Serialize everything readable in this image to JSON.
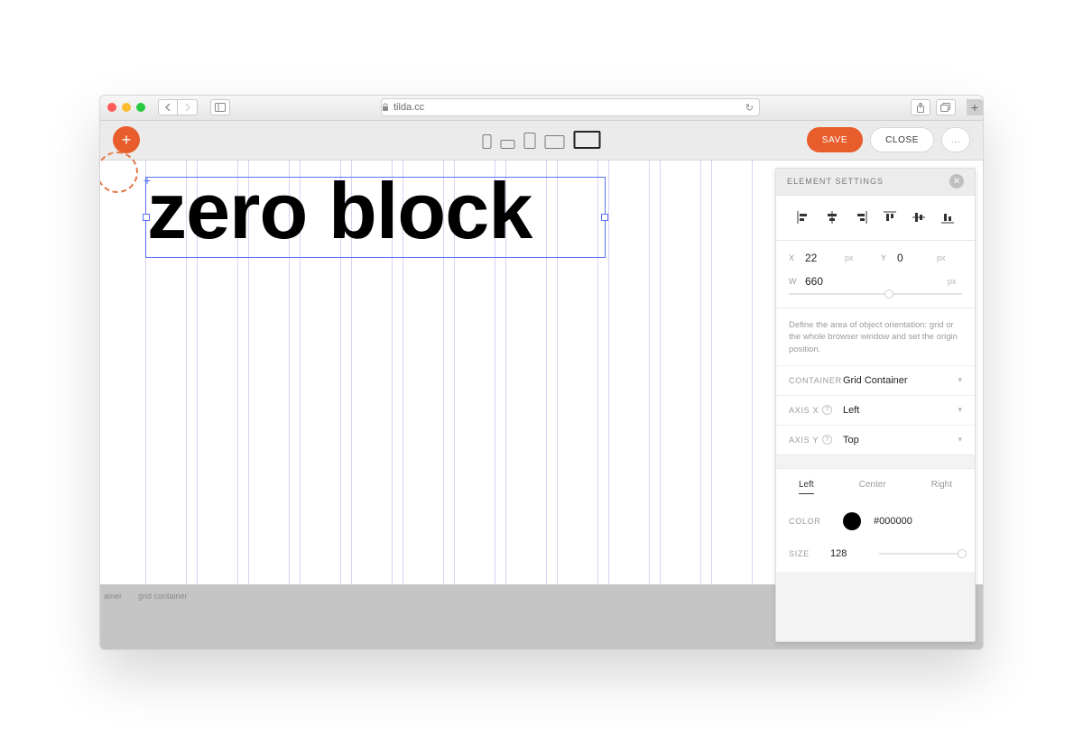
{
  "browser": {
    "url_host": "tilda.cc"
  },
  "toolbar": {
    "save_label": "SAVE",
    "close_label": "CLOSE",
    "more_label": "..."
  },
  "canvas": {
    "text_content": "zero block",
    "ruler": {
      "label_a": "ainer",
      "label_b": "grid container"
    }
  },
  "panel": {
    "title": "ELEMENT SETTINGS",
    "coords": {
      "x_label": "X",
      "x_value": "22",
      "x_unit": "px",
      "y_label": "Y",
      "y_value": "0",
      "y_unit": "px",
      "w_label": "W",
      "w_value": "660",
      "w_unit": "px"
    },
    "description": "Define the area of object orientation: grid or the whole browser window and set the origin position.",
    "container": {
      "label": "CONTAINER",
      "value": "Grid Container"
    },
    "axis_x": {
      "label": "AXIS X",
      "value": "Left"
    },
    "axis_y": {
      "label": "AXIS Y",
      "value": "Top"
    },
    "align_tabs": {
      "left": "Left",
      "center": "Center",
      "right": "Right"
    },
    "color": {
      "label": "COLOR",
      "value": "#000000"
    },
    "size": {
      "label": "SIZE",
      "value": "128"
    }
  }
}
